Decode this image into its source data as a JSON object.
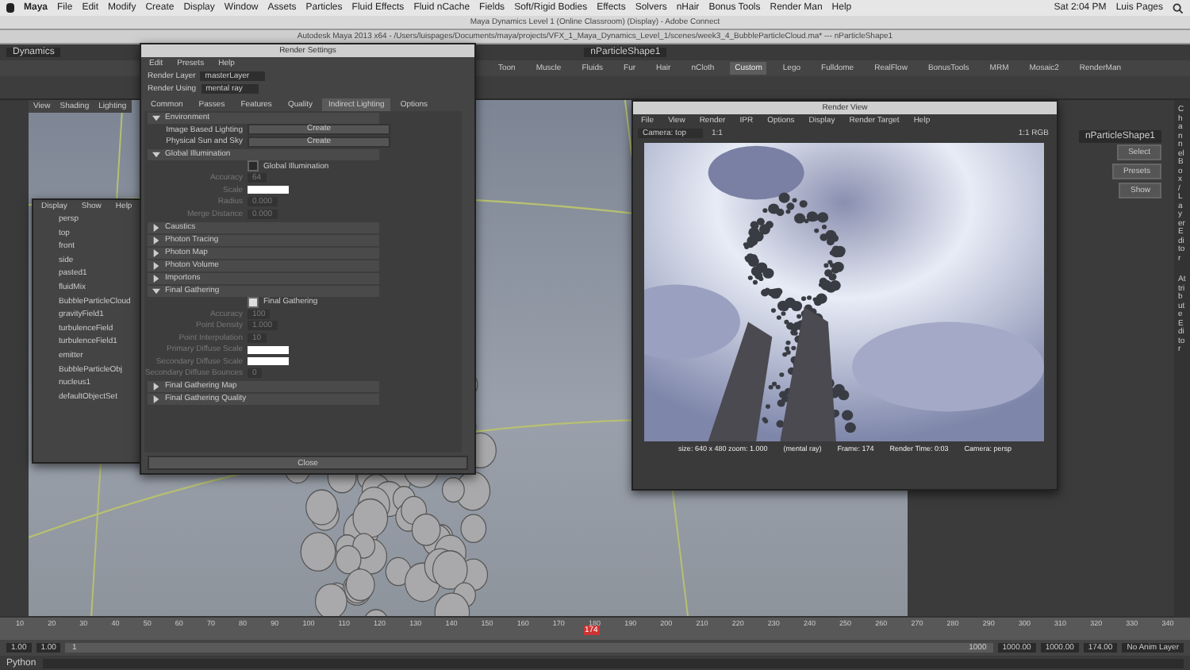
{
  "menubar": {
    "app": "Maya",
    "items": [
      "File",
      "Edit",
      "Modify",
      "Create",
      "Display",
      "Window",
      "Assets",
      "Particles",
      "Fluid Effects",
      "Fluid nCache",
      "Fields",
      "Soft/Rigid Bodies",
      "Effects",
      "Solvers",
      "nHair",
      "Bonus Tools",
      "Render Man",
      "Help"
    ],
    "clock": "Sat 2:04 PM",
    "user": "Luis Pages"
  },
  "meeting_title": "Maya Dynamics Level 1 (Online Classroom) (Display) - Adobe Connect",
  "maya_title": "Autodesk Maya 2013 x64 - /Users/luispages/Documents/maya/projects/VFX_1_Maya_Dynamics_Level_1/scenes/week3_4_BubbleParticleCloud.ma* --- nParticleShape1",
  "status_line": {
    "mode": "Dynamics",
    "object": "nParticleShape1"
  },
  "shelf_tabs": [
    {
      "label": "Toon",
      "selected": false
    },
    {
      "label": "Muscle",
      "selected": false
    },
    {
      "label": "Fluids",
      "selected": false
    },
    {
      "label": "Fur",
      "selected": false
    },
    {
      "label": "Hair",
      "selected": false
    },
    {
      "label": "nCloth",
      "selected": false
    },
    {
      "label": "Custom",
      "selected": true
    },
    {
      "label": "Lego",
      "selected": false
    },
    {
      "label": "Fulldome",
      "selected": false
    },
    {
      "label": "RealFlow",
      "selected": false
    },
    {
      "label": "BonusTools",
      "selected": false
    },
    {
      "label": "MRM",
      "selected": false
    },
    {
      "label": "Mosaic2",
      "selected": false
    },
    {
      "label": "RenderMan",
      "selected": false
    }
  ],
  "panel_menu": [
    "View",
    "Shading",
    "Lighting"
  ],
  "render_settings": {
    "title": "Render Settings",
    "menus": [
      "Edit",
      "Presets",
      "Help"
    ],
    "layer_label": "Render Layer",
    "layer_value": "masterLayer",
    "using_label": "Render Using",
    "using_value": "mental ray",
    "tabs": [
      {
        "label": "Common",
        "selected": false
      },
      {
        "label": "Passes",
        "selected": false
      },
      {
        "label": "Features",
        "selected": false
      },
      {
        "label": "Quality",
        "selected": false
      },
      {
        "label": "Indirect Lighting",
        "selected": true
      },
      {
        "label": "Options",
        "selected": false
      }
    ],
    "rows": [
      {
        "kind": "section",
        "label": "Environment",
        "expanded": true
      },
      {
        "kind": "button",
        "label": "Image Based Lighting",
        "value": "Create"
      },
      {
        "kind": "button",
        "label": "Physical Sun and Sky",
        "value": "Create"
      },
      {
        "kind": "section",
        "label": "Global Illumination",
        "expanded": true
      },
      {
        "kind": "checkbox",
        "label": "Global Illumination",
        "checked": false
      },
      {
        "kind": "field",
        "label": "Accuracy",
        "value": "64"
      },
      {
        "kind": "swatch",
        "label": "Scale"
      },
      {
        "kind": "field",
        "label": "Radius",
        "value": "0.000"
      },
      {
        "kind": "field",
        "label": "Merge Distance",
        "value": "0.000"
      },
      {
        "kind": "section",
        "label": "Caustics",
        "expanded": false
      },
      {
        "kind": "section",
        "label": "Photon Tracing",
        "expanded": false
      },
      {
        "kind": "section",
        "label": "Photon Map",
        "expanded": false
      },
      {
        "kind": "section",
        "label": "Photon Volume",
        "expanded": false
      },
      {
        "kind": "section",
        "label": "Importons",
        "expanded": false
      },
      {
        "kind": "section",
        "label": "Final Gathering",
        "expanded": true
      },
      {
        "kind": "checkbox",
        "label": "Final Gathering",
        "checked": true
      },
      {
        "kind": "field",
        "label": "Accuracy",
        "value": "100"
      },
      {
        "kind": "field",
        "label": "Point Density",
        "value": "1.000"
      },
      {
        "kind": "field",
        "label": "Point Interpolation",
        "value": "10"
      },
      {
        "kind": "swatch",
        "label": "Primary Diffuse Scale"
      },
      {
        "kind": "swatch",
        "label": "Secondary Diffuse Scale"
      },
      {
        "kind": "field",
        "label": "Secondary Diffuse Bounces",
        "value": "0"
      },
      {
        "kind": "section",
        "label": "Final Gathering Map",
        "expanded": false
      },
      {
        "kind": "section",
        "label": "Final Gathering Quality",
        "expanded": false
      }
    ],
    "close": "Close"
  },
  "outliner": {
    "menus": [
      "Display",
      "Show",
      "Help"
    ],
    "items": [
      "persp",
      "top",
      "front",
      "side",
      "pasted1",
      "fluidMix",
      "BubbleParticleCloud",
      "gravityField1",
      "turbulenceField",
      "turbulenceField1",
      "emitter",
      "BubbleParticleObj",
      "nucleus1",
      "defaultObjectSet"
    ]
  },
  "render_view": {
    "title": "Render View",
    "menus": [
      "File",
      "View",
      "Render",
      "IPR",
      "Options",
      "Display",
      "Render Target",
      "Help"
    ],
    "camera": "Camera: top",
    "ratio": "1:1",
    "zoom": "1:1 RGB",
    "info": [
      "size: 640 x 480 zoom: 1.000",
      "(mental ray)",
      "Frame: 174",
      "Render Time: 0:03",
      "Camera: persp"
    ]
  },
  "attribute_editor": {
    "buttons": [
      "Select",
      "Presets",
      "Show"
    ],
    "field": "nParticleShape1",
    "side_tabs": [
      "Channel Box / Layer Editor",
      "Attribute Editor"
    ]
  },
  "timeline": {
    "ticks": [
      "10",
      "20",
      "30",
      "40",
      "50",
      "60",
      "70",
      "80",
      "90",
      "100",
      "110",
      "120",
      "130",
      "140",
      "150",
      "160",
      "170",
      "180",
      "190",
      "200",
      "210",
      "220",
      "230",
      "240",
      "250",
      "260",
      "270",
      "280",
      "290",
      "300",
      "310",
      "320",
      "330",
      "340"
    ],
    "current": "174",
    "level": 0.49,
    "frame_field": "174.00"
  },
  "range": {
    "level": 1.0,
    "start": "1.00",
    "start2": "1.00",
    "range_start": "1",
    "range_end": "1000",
    "end": "1000.00",
    "end2": "1000.00",
    "anim_layer": "No Anim Layer"
  },
  "command_line": {
    "label": "Python"
  }
}
